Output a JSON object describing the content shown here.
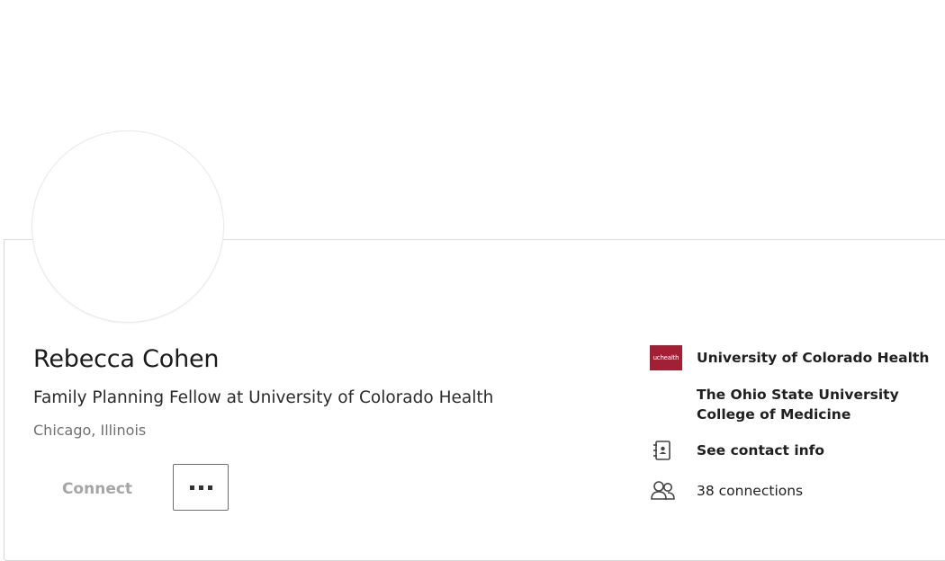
{
  "profile": {
    "name": "Rebecca Cohen",
    "headline": "Family Planning Fellow at University of Colorado Health",
    "location": "Chicago, Illinois"
  },
  "actions": {
    "connect_label": "Connect",
    "more_icon": "more-horizontal-icon"
  },
  "sidebar": {
    "company_logo_text": "uchealth",
    "company": "University of Colorado Health",
    "education": "The Ohio State University College of Medicine",
    "education_line1": "The Ohio State University",
    "education_line2": "College of Medicine",
    "contact_label": "See contact info",
    "contact_icon": "address-book-icon",
    "connections_label": "38 connections",
    "connections_icon": "people-icon"
  },
  "colors": {
    "brand_logo": "#a31f34",
    "connect_disabled": "#a6a6a6"
  }
}
